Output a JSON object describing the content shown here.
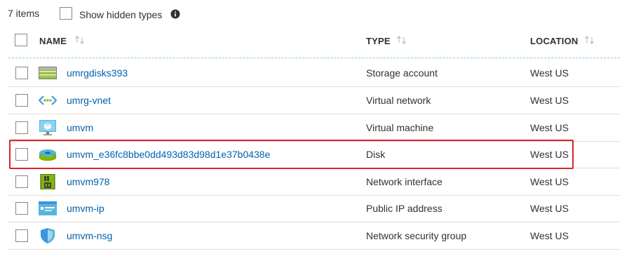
{
  "toolbar": {
    "item_count": "7 items",
    "show_hidden_label": "Show hidden types"
  },
  "columns": [
    {
      "label": "NAME"
    },
    {
      "label": "TYPE"
    },
    {
      "label": "LOCATION"
    }
  ],
  "rows": [
    {
      "name": "umrgdisks393",
      "type": "Storage account",
      "location": "West US",
      "icon": "storage-account-icon"
    },
    {
      "name": "umrg-vnet",
      "type": "Virtual network",
      "location": "West US",
      "icon": "virtual-network-icon"
    },
    {
      "name": "umvm",
      "type": "Virtual machine",
      "location": "West US",
      "icon": "virtual-machine-icon"
    },
    {
      "name": "umvm_e36fc8bbe0dd493d83d98d1e37b0438e",
      "type": "Disk",
      "location": "West US",
      "icon": "disk-icon",
      "highlighted": true
    },
    {
      "name": "umvm978",
      "type": "Network interface",
      "location": "West US",
      "icon": "network-interface-icon"
    },
    {
      "name": "umvm-ip",
      "type": "Public IP address",
      "location": "West US",
      "icon": "public-ip-icon"
    },
    {
      "name": "umvm-nsg",
      "type": "Network security group",
      "location": "West US",
      "icon": "network-security-group-icon"
    }
  ],
  "colors": {
    "link": "#0062ad",
    "highlight_border": "#d9252c"
  }
}
